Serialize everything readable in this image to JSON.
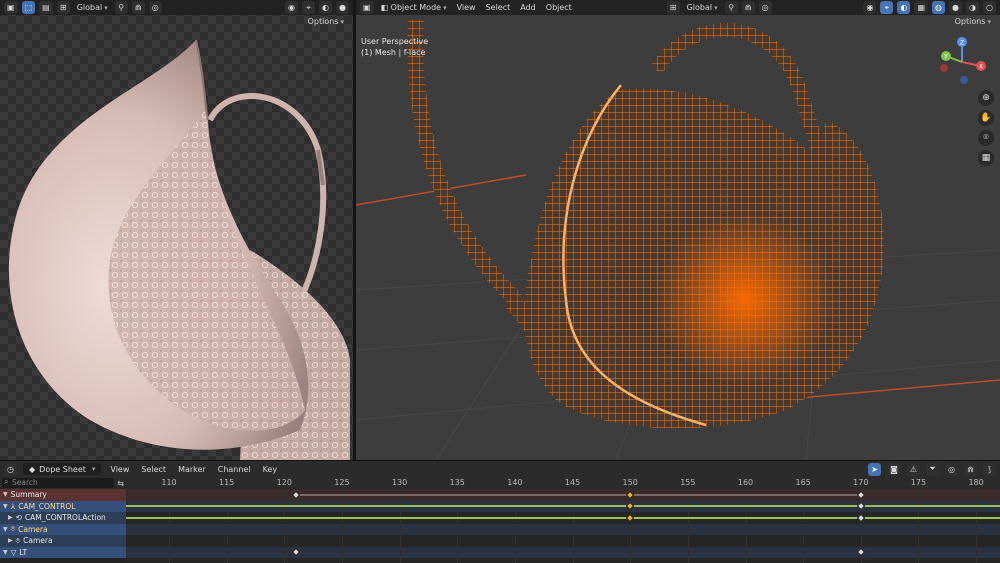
{
  "left_viewport": {
    "transform_orientation": "Global",
    "options_label": "Options"
  },
  "right_viewport": {
    "mode": "Object Mode",
    "menus": [
      "View",
      "Select",
      "Add",
      "Object"
    ],
    "transform_orientation": "Global",
    "options_label": "Options",
    "overlay_line1": "User Perspective",
    "overlay_line2": "(1) Mesh | f-lace",
    "gizmo_axes": {
      "x": "X",
      "y": "Y",
      "z": "Z"
    },
    "nav_icons": [
      "zoom-icon",
      "hand-pan-icon",
      "camera-icon",
      "grid-icon"
    ]
  },
  "dope_sheet": {
    "editor_mode": "Dope Sheet",
    "menus": [
      "View",
      "Select",
      "Marker",
      "Channel",
      "Key"
    ],
    "search_placeholder": "Search",
    "channels": [
      {
        "label": "Summary",
        "kind": "summary"
      },
      {
        "label": "CAM_CONTROL",
        "kind": "object"
      },
      {
        "label": "CAM_CONTROLAction",
        "kind": "action"
      },
      {
        "label": "Camera",
        "kind": "object"
      },
      {
        "label": "Camera",
        "kind": "child"
      },
      {
        "label": "LT",
        "kind": "lt"
      }
    ],
    "frame_ticks": [
      "110",
      "115",
      "120",
      "125",
      "130",
      "135",
      "140",
      "145",
      "150",
      "155",
      "160",
      "165",
      "170",
      "175",
      "180"
    ],
    "keyframes": [
      {
        "row": 0,
        "frames": [
          121,
          150,
          170
        ],
        "selected": [
          150
        ]
      },
      {
        "row": 1,
        "frames": [
          150,
          170
        ],
        "selected": [
          150
        ]
      },
      {
        "row": 2,
        "frames": [
          150,
          170
        ],
        "selected": [
          150
        ]
      },
      {
        "row": 5,
        "frames": [
          121,
          170
        ],
        "selected": []
      }
    ]
  },
  "colors": {
    "accent": "#4772b3",
    "wire_orange": "#ff6a00",
    "keyframe_selected": "#e8b02e",
    "keyframe": "#d8d8d8",
    "hold_line": "#9bbf5a"
  }
}
